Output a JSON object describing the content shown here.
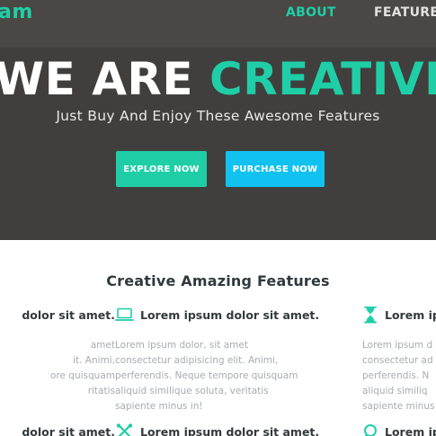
{
  "nav": {
    "brand": "am",
    "links": [
      {
        "label": "ABOUT",
        "active": true
      },
      {
        "label": "FEATURE"
      }
    ]
  },
  "hero": {
    "headline_white": "WE ARE",
    "headline_accent": "CREATIVE",
    "subheadline": "Just Buy And Enjoy These Awesome Features",
    "buttons": {
      "explore": "EXPLORE NOW",
      "purchase": "PURCHASE NOW"
    }
  },
  "features": {
    "title": "Creative Amazing Features",
    "row1": [
      {
        "icon": "none-visible",
        "title": "dolor sit amet.",
        "lines": [
          "amet",
          "it. Animi,",
          "ore quisquam",
          "ritatis"
        ]
      },
      {
        "icon": "laptop-icon",
        "title": "Lorem ipsum dolor sit amet.",
        "lines": [
          "Lorem ipsum dolor, sit amet",
          "consectetur adipisicing elit. Animi,",
          "perferendis. Neque tempore quisquam",
          "aliquid similique soluta, veritatis",
          "sapiente minus in!"
        ]
      },
      {
        "icon": "hourglass-icon",
        "title": "Lorem ip",
        "lines": [
          "Lorem ipsum d",
          "consectetur ad",
          "perferendis. N",
          "aliquid similiq",
          "sapiente minus"
        ]
      }
    ],
    "row2": [
      {
        "title": "dolor sit amet."
      },
      {
        "icon": "tools-icon",
        "title": "Lorem ipsum dolor sit amet."
      },
      {
        "icon": "search-icon",
        "title": "Lorem ip"
      }
    ]
  },
  "colors": {
    "accent": "#1fcea7",
    "purchase": "#11c2f0",
    "hero_bg": "#403f3d",
    "nav_bg": "#4a4744"
  }
}
